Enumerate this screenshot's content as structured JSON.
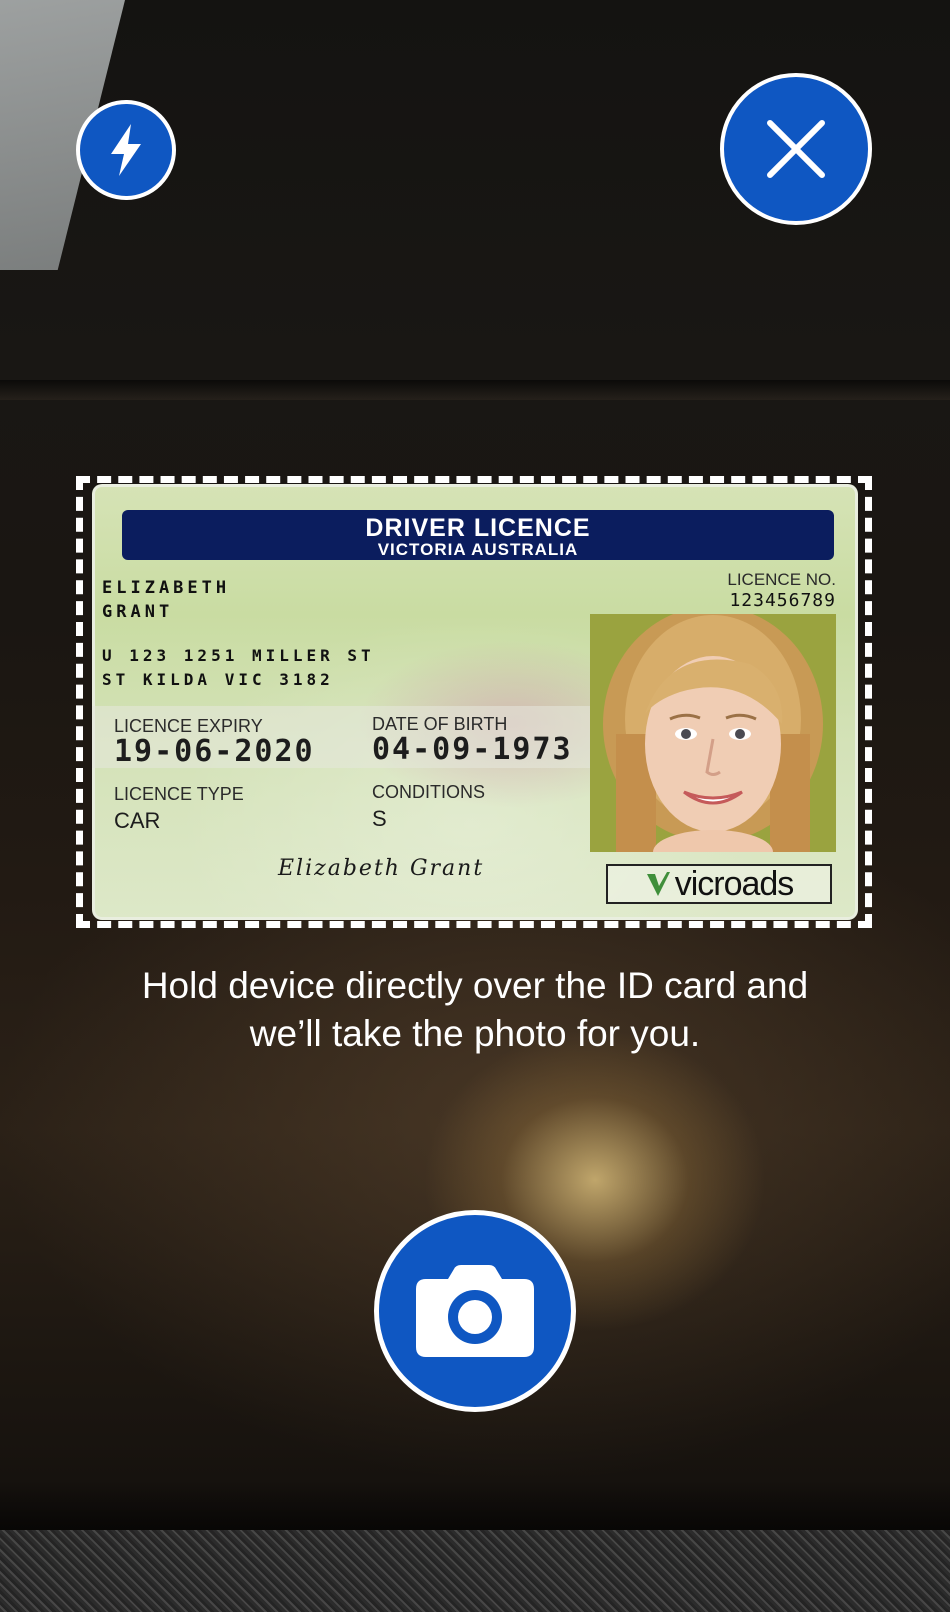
{
  "card": {
    "title": "DRIVER LICENCE",
    "subtitle": "VICTORIA AUSTRALIA",
    "licence_no_label": "LICENCE NO.",
    "licence_no": "123456789",
    "first_name": "ELIZABETH",
    "last_name": "GRANT",
    "address_line1": "U 123 1251 MILLER ST",
    "address_line2": "ST KILDA VIC 3182",
    "expiry_label": "LICENCE EXPIRY",
    "expiry": "19-06-2020",
    "dob_label": "DATE OF BIRTH",
    "dob": "04-09-1973",
    "type_label": "LICENCE TYPE",
    "type": "CAR",
    "conditions_label": "CONDITIONS",
    "conditions": "S",
    "signature": "Elizabeth Grant",
    "issuer_logo": "vicroads"
  },
  "instruction": {
    "line1": "Hold device directly over the ID card and",
    "line2": "we’ll take the photo for you."
  },
  "icons": {
    "flash": "lightning-bolt-icon",
    "close": "close-icon",
    "shutter": "camera-icon"
  },
  "colors": {
    "button_blue": "#0f57c2",
    "card_header": "#0b1d5e",
    "card_background": "#d6e3b6"
  }
}
